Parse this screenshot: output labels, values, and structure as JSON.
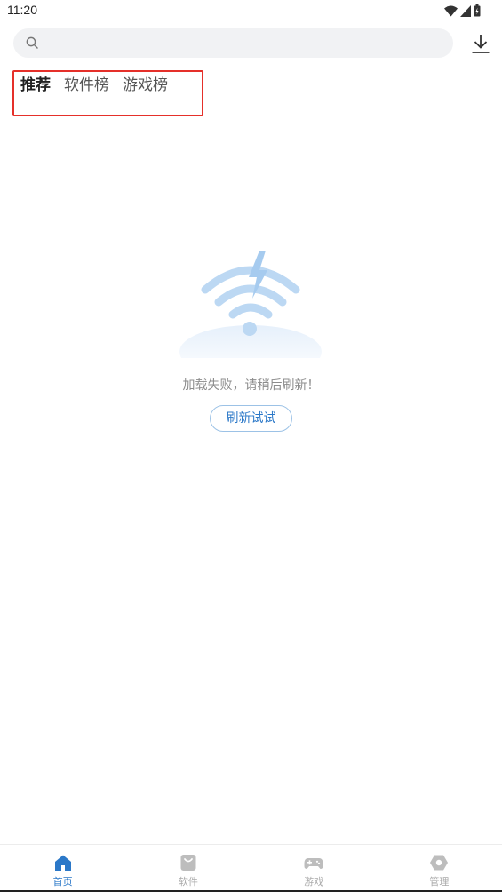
{
  "status_bar": {
    "time": "11:20",
    "icons": [
      "wifi-icon",
      "signal-icon",
      "battery-icon"
    ]
  },
  "search": {
    "placeholder": "",
    "value": ""
  },
  "header": {
    "download_icon": "download-icon"
  },
  "tabs": [
    {
      "label": "推荐",
      "active": true
    },
    {
      "label": "软件榜",
      "active": false
    },
    {
      "label": "游戏榜",
      "active": false
    }
  ],
  "empty_state": {
    "illustration_icon": "network-error-icon",
    "message": "加载失败，请稍后刷新！",
    "refresh_label": "刷新试试"
  },
  "bottom_nav": [
    {
      "label": "首页",
      "icon": "home-icon",
      "active": true
    },
    {
      "label": "软件",
      "icon": "bag-icon",
      "active": false
    },
    {
      "label": "游戏",
      "icon": "gamepad-icon",
      "active": false
    },
    {
      "label": "管理",
      "icon": "hexagon-icon",
      "active": false
    }
  ],
  "colors": {
    "accent": "#2b78c8",
    "highlight_border": "#e5302a",
    "inactive": "#aaaaaa",
    "search_bg": "#f1f2f4"
  }
}
